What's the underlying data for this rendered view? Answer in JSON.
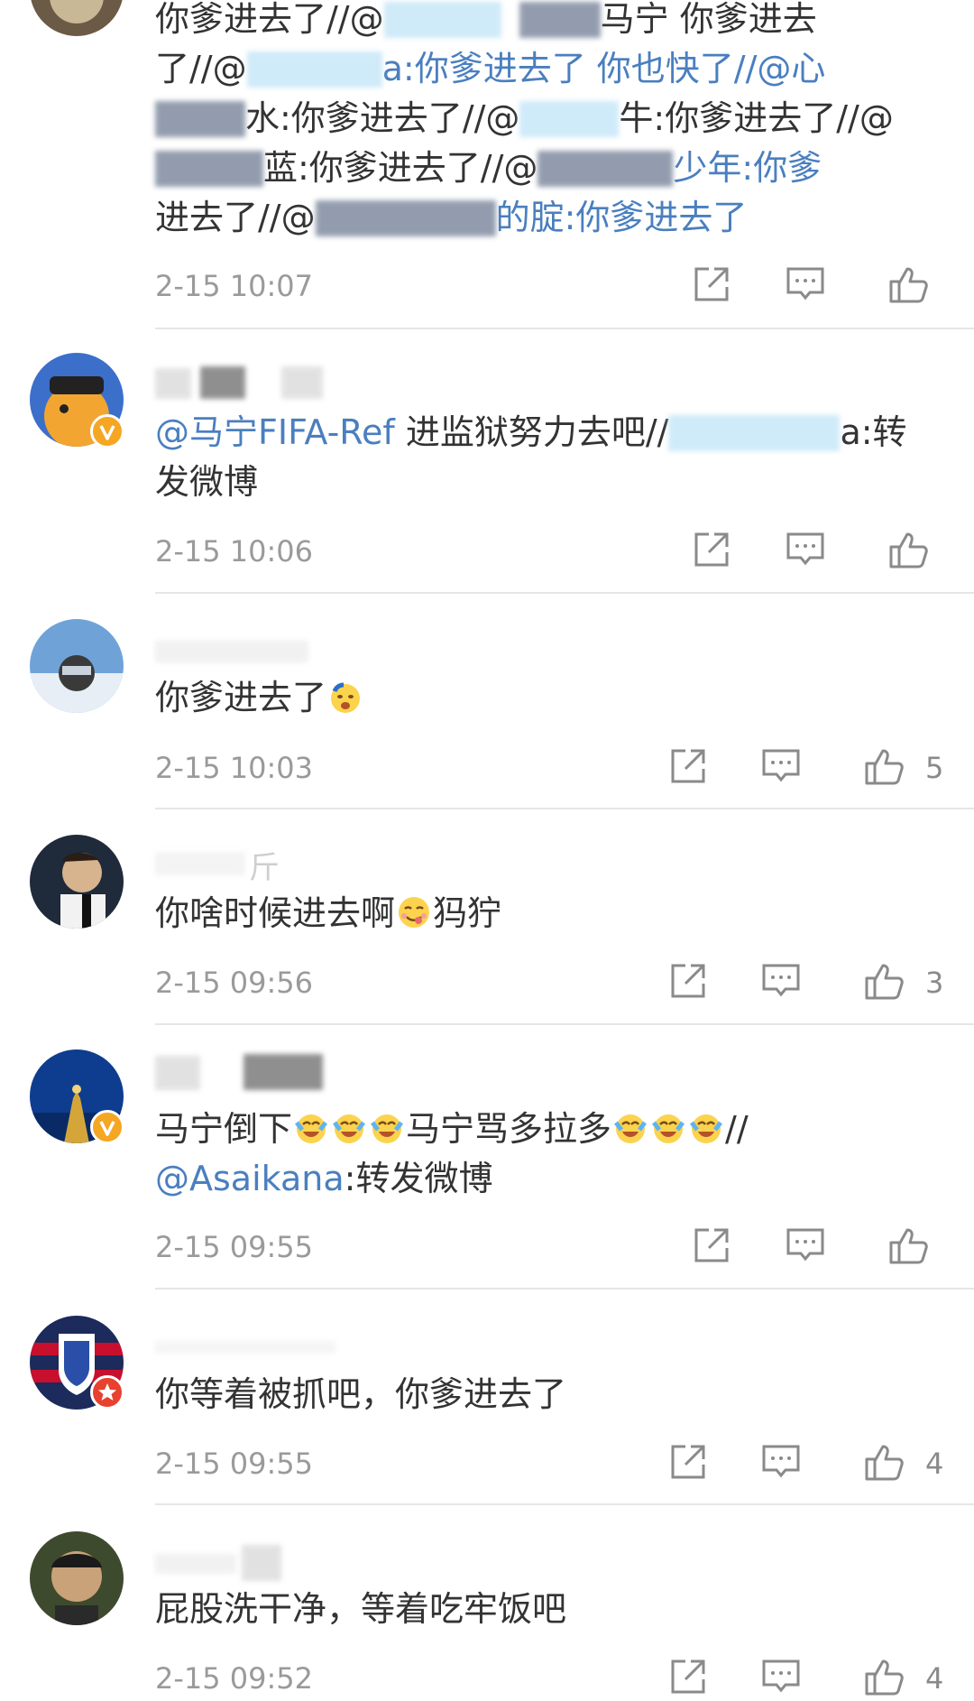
{
  "comments": [
    {
      "text": [
        "你爹进去了//@",
        "马宁 你爹进去",
        "了//@",
        "a:你爹进去了 你也快了//@心",
        "水:你爹进去了//@",
        "牛:你爹进去了//@",
        "蓝:你爹进去了//@",
        "少年:你爹",
        "进去了//@",
        "的腚:你爹进去了"
      ],
      "time": "2-15 10:07",
      "likes": ""
    },
    {
      "mention": "@马宁FIFA-Ref",
      "text": [
        " 进监狱努力去吧//",
        "a:转",
        "发微博"
      ],
      "time": "2-15 10:06",
      "likes": ""
    },
    {
      "text": [
        "你爹进去了"
      ],
      "emoji": "crying-face-emoji",
      "time": "2-15 10:03",
      "likes": "5"
    },
    {
      "text": [
        "你啥时候进去啊",
        "犸狞"
      ],
      "username_fragment": "斤",
      "emoji": "yum-face-emoji",
      "time": "2-15 09:56",
      "likes": "3"
    },
    {
      "text": [
        "马宁倒下",
        "马宁骂多拉多",
        "//"
      ],
      "mention": "@Asaikana",
      "text2": ":转发微博",
      "emoji": "tears-of-joy-emoji",
      "time": "2-15 09:55",
      "likes": ""
    },
    {
      "text": [
        "你等着被抓吧，你爹进去了"
      ],
      "time": "2-15 09:55",
      "likes": "4"
    },
    {
      "text": [
        "屁股洗干净，等着吃牢饭吧"
      ],
      "time": "2-15 09:52",
      "likes": "4"
    }
  ],
  "icons": {
    "share": "share-icon",
    "comment": "comment-icon",
    "like": "thumbs-up-icon",
    "verified": "verified-badge-icon",
    "vip": "vip-badge-icon"
  },
  "colors": {
    "mention": "#4a7fbf",
    "time": "#9a9a9a",
    "badge_yellow": "#f5a623",
    "badge_red": "#e8412f"
  }
}
